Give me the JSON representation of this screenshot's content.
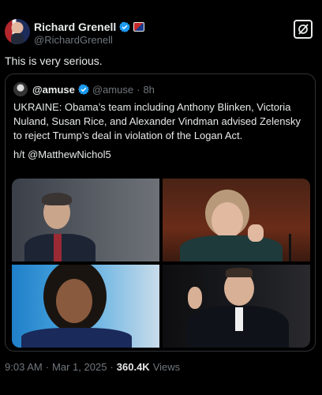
{
  "author": {
    "name": "Richard Grenell",
    "handle": "@RichardGrenell"
  },
  "tweet": {
    "text": "This is very serious."
  },
  "quoted": {
    "name": "@amuse",
    "handle": "@amuse",
    "time": "8h",
    "text": "UKRAINE: Obama’s team including Anthony Blinken, Victoria Nuland, Susan Rice, and Alexander Vindman advised Zelensky to reject Trump’s deal in violation of the Logan Act.",
    "hat_tip": "h/t @MatthewNichol5"
  },
  "meta": {
    "time": "9:03 AM",
    "date": "Mar 1, 2025",
    "views_count": "360.4K",
    "views_label": "Views"
  },
  "colors": {
    "background": "#000000",
    "text": "#e7e9ea",
    "muted": "#71767b",
    "verified": "#1d9bf0",
    "border": "#2f3336"
  },
  "icons": {
    "verified": "verified-badge-icon",
    "grok": "grok-icon"
  }
}
